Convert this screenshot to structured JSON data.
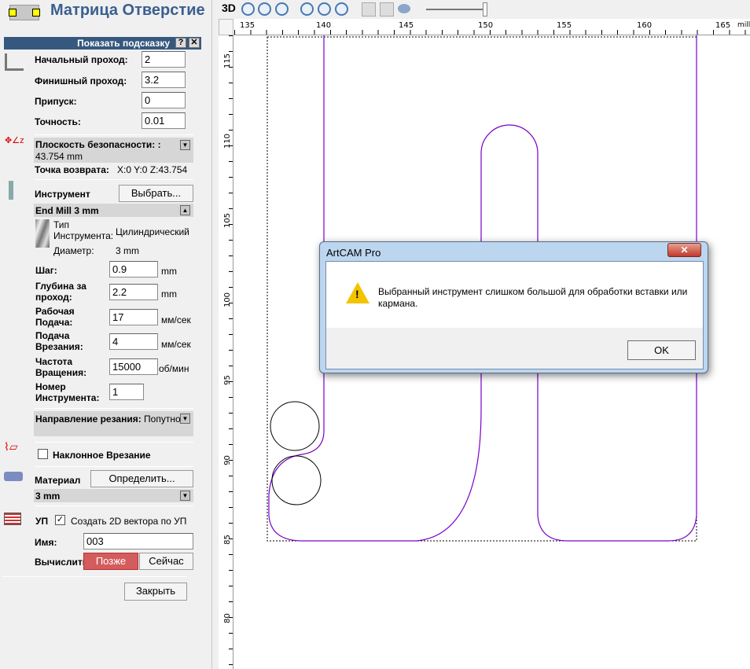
{
  "panel": {
    "title": "Матрица Отверстие",
    "hint_bar": "Показать подсказку",
    "hint_help": "?",
    "hint_close": "✕",
    "start_pass_label": "Начальный проход:",
    "start_pass": "2",
    "finish_pass_label": "Финишный проход:",
    "finish_pass": "3.2",
    "allowance_label": "Припуск:",
    "allowance": "0",
    "tolerance_label": "Точность:",
    "tolerance": "0.01",
    "safe_z_label": "Плоскость безопасности: :",
    "safe_z_value": "43.754 mm",
    "home_label": "Точка возврата:",
    "home_value": "X:0 Y:0 Z:43.754",
    "tool_label": "Инструмент",
    "tool_select": "Выбрать...",
    "tool_name": "End Mill 3 mm",
    "tool_type_label": "Тип Инструмента:",
    "tool_type": "Цилиндрический",
    "diameter_label": "Диаметр:",
    "diameter": "3 mm",
    "stepover_label": "Шаг:",
    "stepover": "0.9",
    "stepover_unit": "mm",
    "stepdown_label": "Глубина за проход:",
    "stepdown": "2.2",
    "stepdown_unit": "mm",
    "feed_label": "Рабочая Подача:",
    "feed": "17",
    "feed_unit": "мм/сек",
    "plunge_label": "Подача Врезания:",
    "plunge": "4",
    "plunge_unit": "мм/сек",
    "spindle_label": "Частота Вращения:",
    "spindle": "15000",
    "spindle_unit": "об/мин",
    "toolnum_label": "Номер Инструмента:",
    "toolnum": "1",
    "direction_label": "Направление резания:",
    "direction": "Попутное",
    "ramp_label": "Наклонное Врезание",
    "ramp_checked": false,
    "material_label": "Материал",
    "material_btn": "Определить...",
    "material_value": "3 mm",
    "toolpath_label": "УП",
    "create_vectors_label": "Создать 2D вектора по УП",
    "create_vectors_checked": true,
    "name_label": "Имя:",
    "name": "003",
    "calc_label": "Вычислить:",
    "later": "Позже",
    "now": "Сейчас",
    "close": "Закрыть"
  },
  "toolbar": {
    "view3d": "3D",
    "icons": [
      "zoom-in-icon",
      "zoom-out-icon",
      "zoom-previous-icon",
      "zoom-1to1-icon",
      "zoom-fit-icon",
      "zoom-all-icon",
      "import-icon",
      "export-icon",
      "eye-icon"
    ],
    "slider": 1.0
  },
  "ruler": {
    "x_ticks": [
      "135",
      "140",
      "145",
      "150",
      "155",
      "160",
      "165"
    ],
    "unit": "milli",
    "y_ticks": [
      "115",
      "110",
      "105",
      "100",
      "95",
      "90",
      "85",
      "80"
    ]
  },
  "dialog": {
    "title": "ArtCAM Pro",
    "message": "Выбранный инструмент слишком большой для обработки вставки или кармана.",
    "ok": "OK",
    "close": "✕"
  },
  "colors": {
    "vector": "#7a00c8",
    "hint_bar": "#36587f",
    "later_button": "#d45c5c"
  }
}
